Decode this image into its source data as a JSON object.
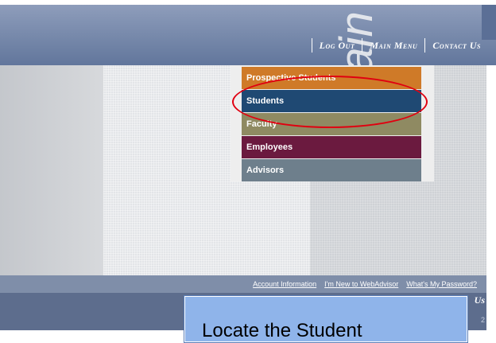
{
  "header": {
    "nav": [
      "Log Out",
      "Main Menu",
      "Contact Us"
    ]
  },
  "menu": {
    "items": [
      {
        "label": "Prospective Students",
        "color": "#cf7a28"
      },
      {
        "label": "Students",
        "color": "#1f4973"
      },
      {
        "label": "Faculty",
        "color": "#8f8a62"
      },
      {
        "label": "Employees",
        "color": "#6b1a3f"
      },
      {
        "label": "Advisors",
        "color": "#6e7f8c"
      }
    ]
  },
  "watermark": "main",
  "links": [
    "Account Information",
    "I'm New to WebAdvisor",
    "What's My Password?"
  ],
  "footer": {
    "side_text": "Us",
    "version": "2"
  },
  "callout": {
    "text": "Locate the Student"
  }
}
